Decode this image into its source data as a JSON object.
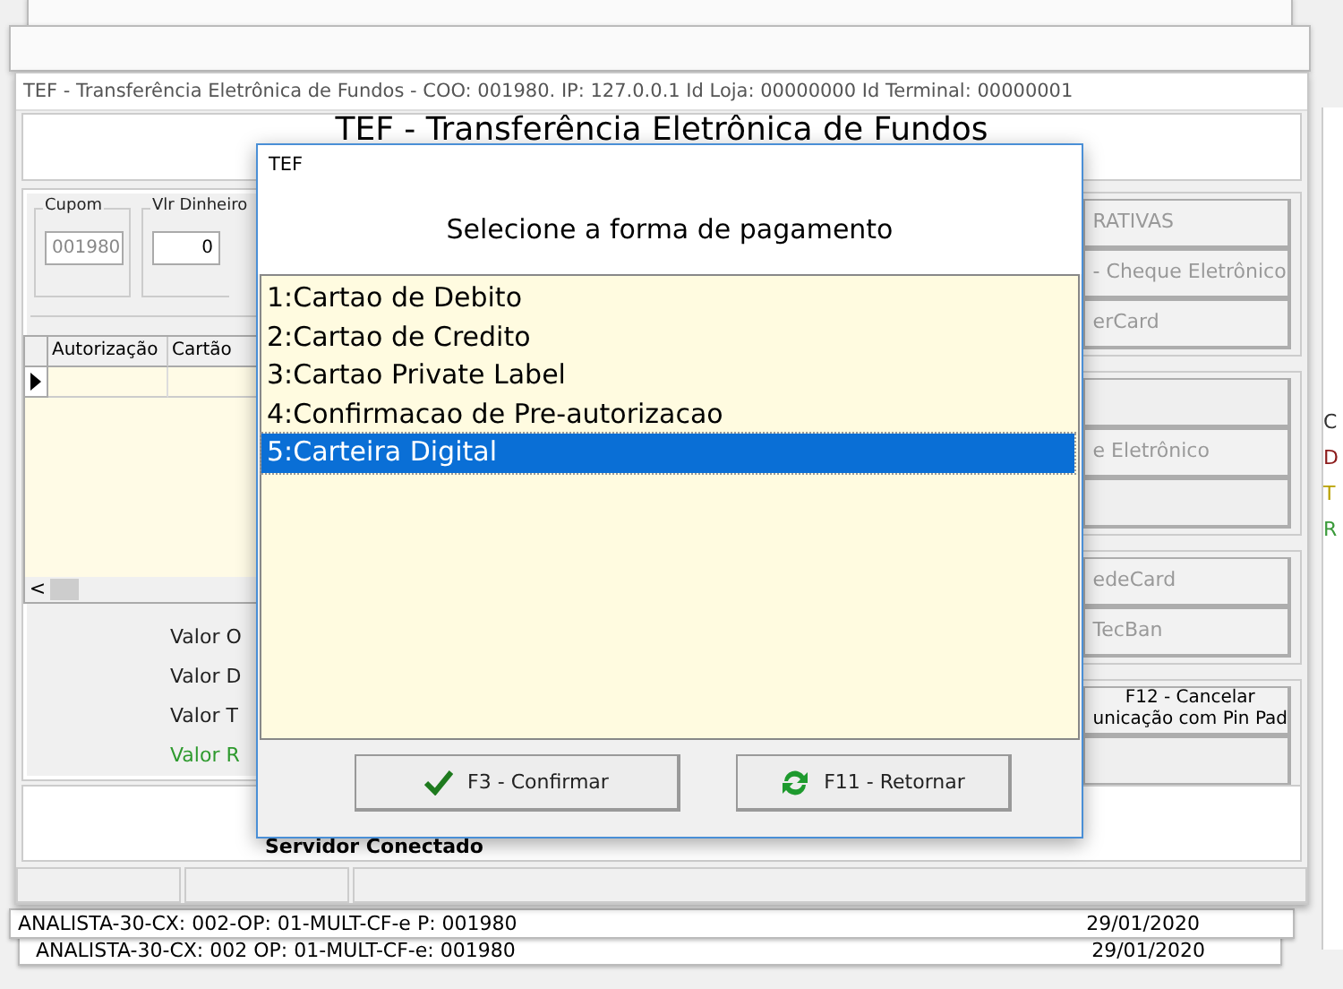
{
  "main_window": {
    "title": "TEF - Transferência Eletrônica de Fundos - COO: 001980. IP: 127.0.0.1 Id Loja: 00000000 Id Terminal: 00000001",
    "heading": "TEF - Transferência Eletrônica de Fundos",
    "cupom": {
      "label": "Cupom",
      "value": "001980"
    },
    "vlr_dinheiro": {
      "label": "Vlr Dinheiro",
      "value": "0"
    },
    "grid": {
      "columns": [
        "Autorização",
        "Cartão"
      ]
    },
    "scroll_left": "<",
    "totals": [
      {
        "label": "Valor O",
        "kind": "normal"
      },
      {
        "label": "Valor D",
        "kind": "normal"
      },
      {
        "label": "Valor T",
        "kind": "normal"
      },
      {
        "label": "Valor R",
        "kind": "highlight"
      }
    ],
    "right_groups": [
      {
        "buttons": [
          {
            "kind": "labeled",
            "lines": [
              "RATIVAS"
            ]
          },
          {
            "kind": "labeled",
            "lines": [
              "- Cheque Eletrônico"
            ]
          },
          {
            "kind": "labeled",
            "lines": [
              "erCard"
            ]
          }
        ]
      },
      {
        "buttons": [
          {
            "kind": "blank"
          },
          {
            "kind": "labeled",
            "lines": [
              "e Eletrônico"
            ]
          },
          {
            "kind": "blank"
          }
        ]
      },
      {
        "buttons": [
          {
            "kind": "labeled",
            "lines": [
              "edeCard"
            ]
          },
          {
            "kind": "labeled",
            "lines": [
              "TecBan"
            ]
          }
        ]
      },
      {
        "buttons": [
          {
            "kind": "labeled",
            "lines": [
              "F12 - Cancelar",
              "unicação com Pin Pad"
            ]
          },
          {
            "kind": "blank"
          }
        ]
      }
    ],
    "server_status": "Servidor Conectado"
  },
  "side_window": {
    "letters": [
      {
        "text": "C",
        "color": "#333333"
      },
      {
        "text": "D",
        "color": "#8b1a1a"
      },
      {
        "text": "T",
        "color": "#b8a000"
      },
      {
        "text": "R",
        "color": "#3a9a3a"
      }
    ]
  },
  "status_bars": [
    {
      "text": "ANALISTA-30-CX: 002-OP: 01-MULT-CF-e P: 001980",
      "date": "29/01/2020"
    },
    {
      "text": "ANALISTA-30-CX: 002 OP: 01-MULT-CF-e: 001980",
      "date": "29/01/2020"
    }
  ],
  "dialog": {
    "title": "TEF",
    "prompt": "Selecione a forma de pagamento",
    "options": [
      {
        "label": "1:Cartao de Debito",
        "selected": false
      },
      {
        "label": "2:Cartao de Credito",
        "selected": false
      },
      {
        "label": "3:Cartao Private Label",
        "selected": false
      },
      {
        "label": "4:Confirmacao de Pre-autorizacao",
        "selected": false
      },
      {
        "label": "5:Carteira Digital",
        "selected": true
      }
    ],
    "buttons": [
      {
        "label": "F3 - Confirmar",
        "kind": "confirm"
      },
      {
        "label": "F11 - Retornar",
        "kind": "return"
      }
    ]
  }
}
